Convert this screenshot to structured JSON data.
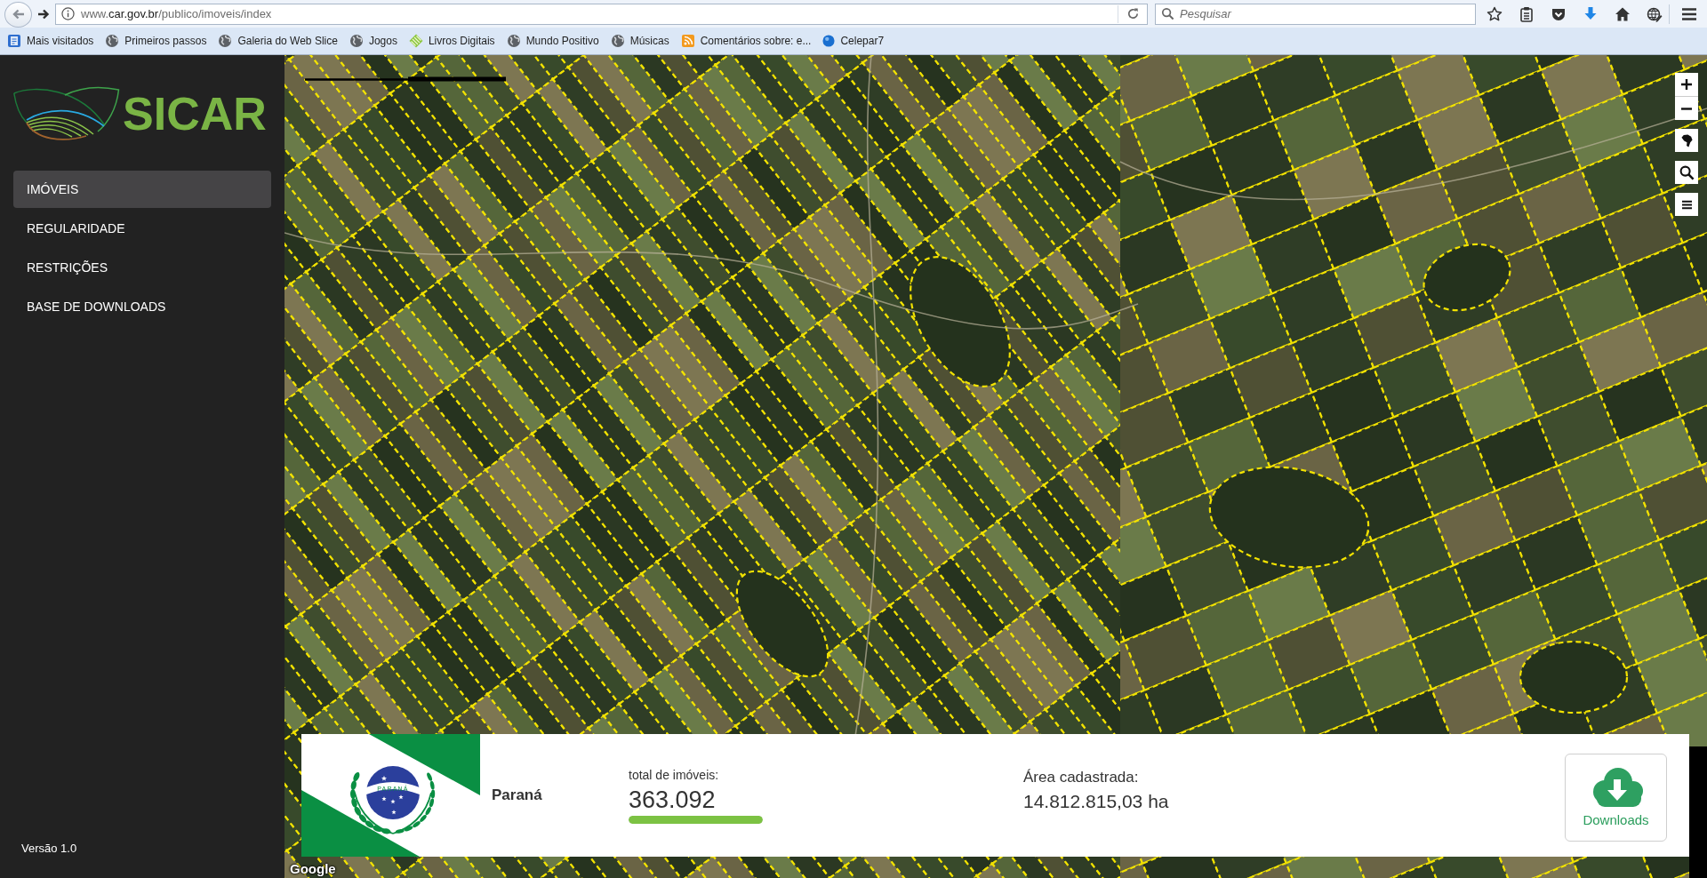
{
  "browser": {
    "url": "www.**car.gov.br**/publico/imoveis/index",
    "search": {
      "placeholder": "Pesquisar"
    },
    "bookmarks": [
      {
        "label": "Mais visitados",
        "kind": "page"
      },
      {
        "label": "Primeiros passos",
        "kind": "globe"
      },
      {
        "label": "Galeria do Web Slice",
        "kind": "globe"
      },
      {
        "label": "Jogos",
        "kind": "globe"
      },
      {
        "label": "Livros Digitais",
        "kind": "diamond"
      },
      {
        "label": "Mundo Positivo",
        "kind": "globe"
      },
      {
        "label": "Músicas",
        "kind": "globe"
      },
      {
        "label": "Comentários sobre: e...",
        "kind": "feed"
      },
      {
        "label": "Celepar7",
        "kind": "orb"
      }
    ]
  },
  "sidebar": {
    "logo": "SICAR",
    "items": [
      {
        "label": "IMÓVEIS",
        "selected": true
      },
      {
        "label": "REGULARIDADE",
        "selected": false
      },
      {
        "label": "RESTRIÇÕES",
        "selected": false
      },
      {
        "label": "BASE DE DOWNLOADS",
        "selected": false
      }
    ],
    "version": "Versão 1.0"
  },
  "map": {
    "attribution": "Google",
    "summary": {
      "flag_banner": "PARANÁ",
      "state": "Paraná",
      "total_label": "total de imóveis:",
      "total_value": "363.092",
      "level": 1,
      "area_label": "Área cadastrada:",
      "area_value": "14.812.815,03 ha",
      "download_button": "Downloads"
    }
  }
}
